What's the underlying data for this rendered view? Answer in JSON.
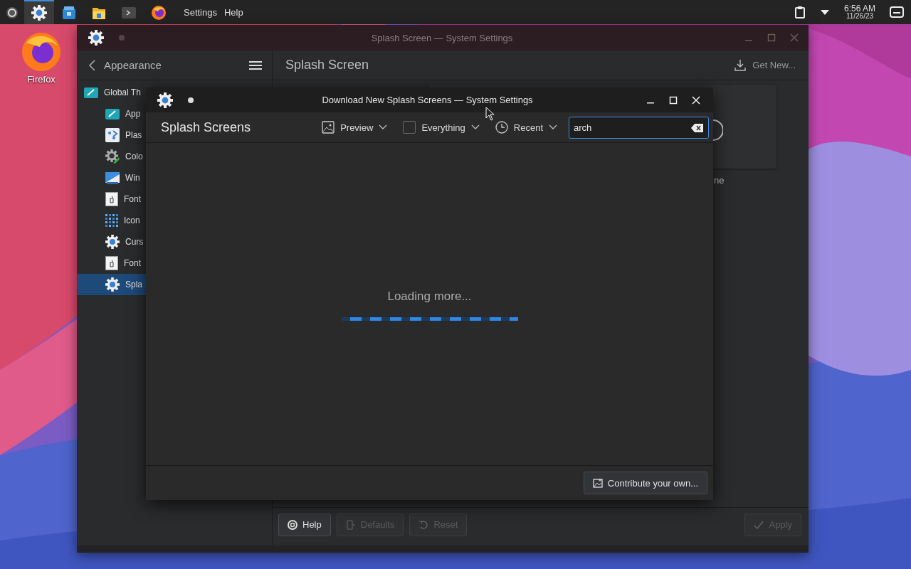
{
  "taskbar": {
    "apps": [
      {
        "selected": false
      },
      {
        "selected": true
      },
      {
        "selected": false
      },
      {
        "selected": false
      },
      {
        "selected": false
      },
      {
        "selected": false
      }
    ],
    "menu": [
      "Settings",
      "Help"
    ],
    "time": "6:56 AM",
    "date": "11/26/23"
  },
  "desktop_icons": [
    {
      "label": "Firefox"
    }
  ],
  "window": {
    "title": "Splash Screen — System Settings",
    "sidebar": {
      "header": "Appearance",
      "items": [
        {
          "label": "Global Th",
          "selected": false,
          "children": [
            {
              "label": "App",
              "selected": false
            },
            {
              "label": "Plas",
              "selected": false
            },
            {
              "label": "Colo",
              "selected": false
            },
            {
              "label": "Win",
              "selected": false
            },
            {
              "label": "Font",
              "selected": false
            },
            {
              "label": "Icon",
              "selected": false
            },
            {
              "label": "Curs",
              "selected": false
            },
            {
              "label": "Font",
              "selected": false
            },
            {
              "label": "Spla",
              "selected": true
            }
          ]
        }
      ]
    },
    "page_title": "Splash Screen",
    "get_new": "Get New...",
    "partial_text": "ne",
    "buttons": [
      {
        "label": "Help",
        "disabled": false
      },
      {
        "label": "Defaults",
        "disabled": true
      },
      {
        "label": "Reset",
        "disabled": true
      }
    ],
    "apply": {
      "label": "Apply",
      "disabled": true
    }
  },
  "dialog": {
    "title": "Download New Splash Screens — System Settings",
    "heading": "Splash Screens",
    "filters": [
      {
        "kind": "view",
        "label": "Preview"
      },
      {
        "kind": "checkbox",
        "label": "Everything",
        "checked": false
      },
      {
        "kind": "sort",
        "label": "Recent"
      }
    ],
    "search": {
      "value": "arch",
      "focused": true
    },
    "status": "Loading more...",
    "contribute": "Contribute your own..."
  }
}
